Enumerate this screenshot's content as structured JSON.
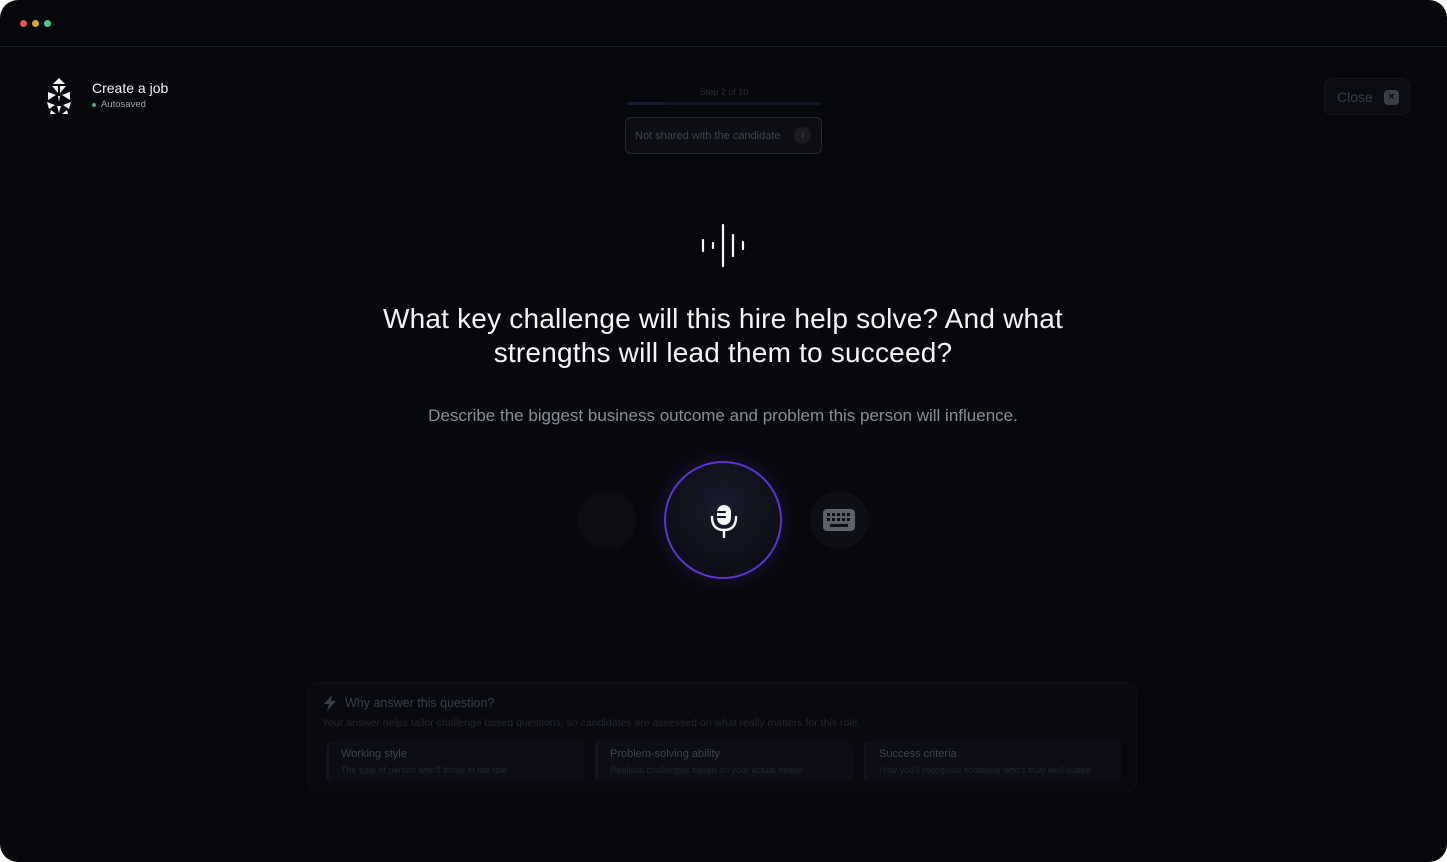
{
  "app": {
    "title": "Create a job",
    "save_status": "Autosaved"
  },
  "progress": {
    "step_label": "Step 2 of 10",
    "current_step": 2,
    "total_steps": 10
  },
  "notice": {
    "text": "Not shared with the candidate",
    "icon": "info-icon",
    "icon_glyph": "i"
  },
  "close_button": {
    "label": "Close",
    "icon_glyph": "×"
  },
  "question": {
    "line1": "What key challenge will this hire help solve? And what",
    "line2": "strengths will lead them to succeed?",
    "subtitle": "Describe the biggest business outcome and problem this person will influence."
  },
  "controls": {
    "left": "empty-button",
    "center": "microphone-icon",
    "right": "keyboard-icon"
  },
  "why_panel": {
    "title": "Why answer this question?",
    "description": "Your answer helps tailor challenge based questions, so candidates are assessed on what really matters for this role.",
    "cards": [
      {
        "title": "Working style",
        "description": "The type of person who'll thrive in the role"
      },
      {
        "title": "Problem-solving ability",
        "description": "Realistic challenges based on your actual needs"
      },
      {
        "title": "Success criteria",
        "description": "How you'll recognise someone who's truly well-suited"
      }
    ]
  },
  "colors": {
    "background": "#07080c",
    "accent": "#5b35c9",
    "status_green": "#3fae6c"
  }
}
